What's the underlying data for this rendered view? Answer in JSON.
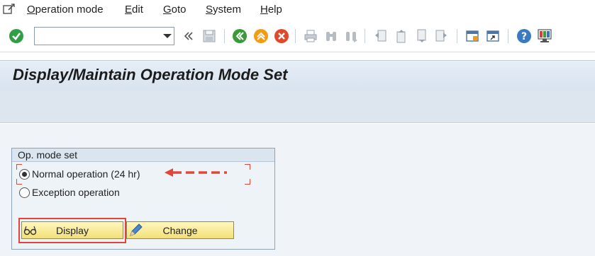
{
  "menubar": {
    "items": [
      {
        "underlined": "O",
        "rest": "peration mode"
      },
      {
        "underlined": "E",
        "rest": "dit"
      },
      {
        "underlined": "G",
        "rest": "oto"
      },
      {
        "underlined": "S",
        "rest": "ystem"
      },
      {
        "underlined": "H",
        "rest": "elp"
      }
    ]
  },
  "toolbar": {
    "command_field_value": "",
    "icons": [
      "enter-check-icon",
      "collapse-icon",
      "save-icon",
      "back-icon",
      "exit-icon",
      "cancel-icon",
      "print-icon",
      "find-icon",
      "find-next-icon",
      "first-page-icon",
      "previous-page-icon",
      "next-page-icon",
      "last-page-icon",
      "create-session-icon",
      "shortcut-icon",
      "help-icon",
      "customize-layout-icon"
    ]
  },
  "page": {
    "title": "Display/Maintain Operation Mode Set"
  },
  "group": {
    "title": "Op. mode set",
    "options": [
      {
        "label": "Normal operation (24 hr)",
        "selected": true
      },
      {
        "label": "Exception operation",
        "selected": false
      }
    ],
    "buttons": {
      "display": "Display",
      "change": "Change"
    }
  },
  "colors": {
    "annotation": "#e0463a",
    "button_fill": "#f3df78",
    "title_band": "#dde6ef"
  }
}
